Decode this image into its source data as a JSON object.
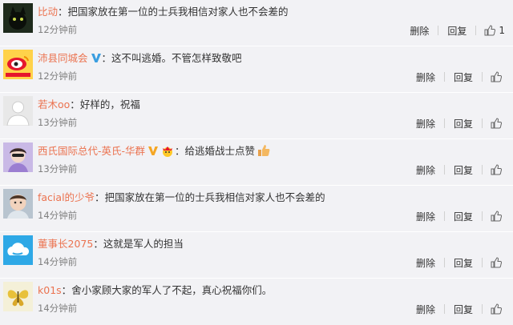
{
  "comments": [
    {
      "user": "比动",
      "verified": false,
      "emoji": false,
      "text": "把国家放在第一位的士兵我相信对家人也不会差的",
      "time": "12分钟前",
      "delete": "删除",
      "reply": "回复",
      "likes": "1",
      "avatar": "avatar-cat-black"
    },
    {
      "user": "沛县同城会",
      "verified": true,
      "emoji": false,
      "text": "这不叫逃婚。不管怎样致敬吧",
      "time": "12分钟前",
      "delete": "删除",
      "reply": "回复",
      "likes": "",
      "avatar": "avatar-weibo-logo"
    },
    {
      "user": "若木oo",
      "verified": false,
      "emoji": false,
      "text": "好样的，祝福",
      "time": "13分钟前",
      "delete": "删除",
      "reply": "回复",
      "likes": "",
      "avatar": "avatar-default"
    },
    {
      "user": "西氏国际总代-英氏-华群",
      "verified": true,
      "emoji": true,
      "text": "给逃婚战士点赞",
      "time": "13分钟前",
      "delete": "删除",
      "reply": "回复",
      "likes": "",
      "avatar": "avatar-girl"
    },
    {
      "user": "facial的少爷",
      "verified": false,
      "emoji": false,
      "text": "把国家放在第一位的士兵我相信对家人也不会差的",
      "time": "14分钟前",
      "delete": "删除",
      "reply": "回复",
      "likes": "",
      "avatar": "avatar-child"
    },
    {
      "user": "董事长2075",
      "verified": false,
      "emoji": false,
      "text": "这就是军人的担当",
      "time": "14分钟前",
      "delete": "删除",
      "reply": "回复",
      "likes": "",
      "avatar": "avatar-cloud"
    },
    {
      "user": "k01s",
      "verified": false,
      "emoji": false,
      "text": "舍小家顾大家的军人了不起，真心祝福你们。",
      "time": "14分钟前",
      "delete": "删除",
      "reply": "回复",
      "likes": "",
      "avatar": "avatar-butterfly"
    }
  ],
  "colors": {
    "username": "#eb7350",
    "row_bg": "#f2f2f5",
    "time": "#808080"
  }
}
